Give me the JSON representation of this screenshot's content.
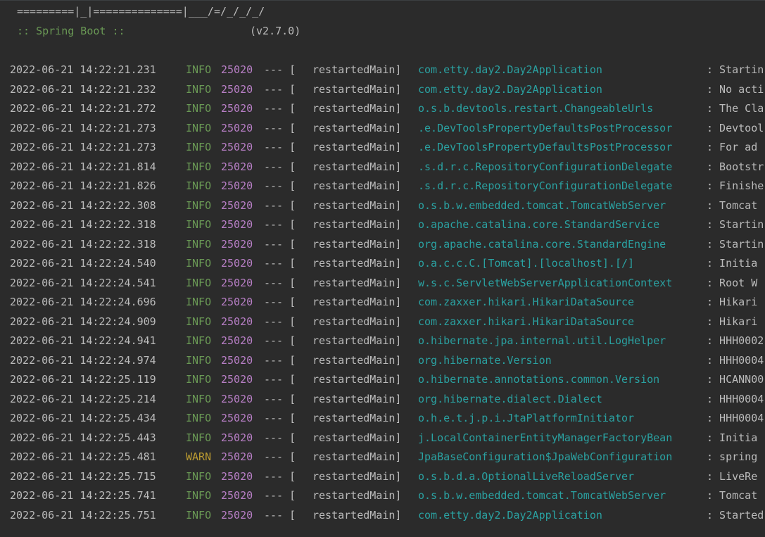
{
  "banner": {
    "art_line": "=========|_|==============|___/=/_/_/_/",
    "spring_boot_label": ":: Spring Boot ::",
    "version": "(v2.7.0)"
  },
  "colors": {
    "background": "#2b2b2b",
    "text": "#bbbbbb",
    "info": "#6a9955",
    "warn": "#bb9b31",
    "pid": "#b87fc6",
    "logger": "#2aa1a1"
  },
  "log": [
    {
      "timestamp": "2022-06-21 14:22:21.231",
      "level": "INFO",
      "pid": "25020",
      "sep": "--- [",
      "thread": "restartedMain]",
      "logger": "com.etty.day2.Day2Application",
      "message": ": Startin"
    },
    {
      "timestamp": "2022-06-21 14:22:21.232",
      "level": "INFO",
      "pid": "25020",
      "sep": "--- [",
      "thread": "restartedMain]",
      "logger": "com.etty.day2.Day2Application",
      "message": ": No acti"
    },
    {
      "timestamp": "2022-06-21 14:22:21.272",
      "level": "INFO",
      "pid": "25020",
      "sep": "--- [",
      "thread": "restartedMain]",
      "logger": "o.s.b.devtools.restart.ChangeableUrls",
      "message": ": The Cla"
    },
    {
      "timestamp": "2022-06-21 14:22:21.273",
      "level": "INFO",
      "pid": "25020",
      "sep": "--- [",
      "thread": "restartedMain]",
      "logger": ".e.DevToolsPropertyDefaultsPostProcessor",
      "message": ": Devtool"
    },
    {
      "timestamp": "2022-06-21 14:22:21.273",
      "level": "INFO",
      "pid": "25020",
      "sep": "--- [",
      "thread": "restartedMain]",
      "logger": ".e.DevToolsPropertyDefaultsPostProcessor",
      "message": ": For ad"
    },
    {
      "timestamp": "2022-06-21 14:22:21.814",
      "level": "INFO",
      "pid": "25020",
      "sep": "--- [",
      "thread": "restartedMain]",
      "logger": ".s.d.r.c.RepositoryConfigurationDelegate",
      "message": ": Bootstr"
    },
    {
      "timestamp": "2022-06-21 14:22:21.826",
      "level": "INFO",
      "pid": "25020",
      "sep": "--- [",
      "thread": "restartedMain]",
      "logger": ".s.d.r.c.RepositoryConfigurationDelegate",
      "message": ": Finishe"
    },
    {
      "timestamp": "2022-06-21 14:22:22.308",
      "level": "INFO",
      "pid": "25020",
      "sep": "--- [",
      "thread": "restartedMain]",
      "logger": "o.s.b.w.embedded.tomcat.TomcatWebServer",
      "message": ": Tomcat"
    },
    {
      "timestamp": "2022-06-21 14:22:22.318",
      "level": "INFO",
      "pid": "25020",
      "sep": "--- [",
      "thread": "restartedMain]",
      "logger": "o.apache.catalina.core.StandardService",
      "message": ": Startin"
    },
    {
      "timestamp": "2022-06-21 14:22:22.318",
      "level": "INFO",
      "pid": "25020",
      "sep": "--- [",
      "thread": "restartedMain]",
      "logger": "org.apache.catalina.core.StandardEngine",
      "message": ": Startin"
    },
    {
      "timestamp": "2022-06-21 14:22:24.540",
      "level": "INFO",
      "pid": "25020",
      "sep": "--- [",
      "thread": "restartedMain]",
      "logger": "o.a.c.c.C.[Tomcat].[localhost].[/]",
      "message": ": Initia"
    },
    {
      "timestamp": "2022-06-21 14:22:24.541",
      "level": "INFO",
      "pid": "25020",
      "sep": "--- [",
      "thread": "restartedMain]",
      "logger": "w.s.c.ServletWebServerApplicationContext",
      "message": ": Root W"
    },
    {
      "timestamp": "2022-06-21 14:22:24.696",
      "level": "INFO",
      "pid": "25020",
      "sep": "--- [",
      "thread": "restartedMain]",
      "logger": "com.zaxxer.hikari.HikariDataSource",
      "message": ": Hikari"
    },
    {
      "timestamp": "2022-06-21 14:22:24.909",
      "level": "INFO",
      "pid": "25020",
      "sep": "--- [",
      "thread": "restartedMain]",
      "logger": "com.zaxxer.hikari.HikariDataSource",
      "message": ": Hikari"
    },
    {
      "timestamp": "2022-06-21 14:22:24.941",
      "level": "INFO",
      "pid": "25020",
      "sep": "--- [",
      "thread": "restartedMain]",
      "logger": "o.hibernate.jpa.internal.util.LogHelper",
      "message": ": HHH0002"
    },
    {
      "timestamp": "2022-06-21 14:22:24.974",
      "level": "INFO",
      "pid": "25020",
      "sep": "--- [",
      "thread": "restartedMain]",
      "logger": "org.hibernate.Version",
      "message": ": HHH0004"
    },
    {
      "timestamp": "2022-06-21 14:22:25.119",
      "level": "INFO",
      "pid": "25020",
      "sep": "--- [",
      "thread": "restartedMain]",
      "logger": "o.hibernate.annotations.common.Version",
      "message": ": HCANN00"
    },
    {
      "timestamp": "2022-06-21 14:22:25.214",
      "level": "INFO",
      "pid": "25020",
      "sep": "--- [",
      "thread": "restartedMain]",
      "logger": "org.hibernate.dialect.Dialect",
      "message": ": HHH0004"
    },
    {
      "timestamp": "2022-06-21 14:22:25.434",
      "level": "INFO",
      "pid": "25020",
      "sep": "--- [",
      "thread": "restartedMain]",
      "logger": "o.h.e.t.j.p.i.JtaPlatformInitiator",
      "message": ": HHH0004"
    },
    {
      "timestamp": "2022-06-21 14:22:25.443",
      "level": "INFO",
      "pid": "25020",
      "sep": "--- [",
      "thread": "restartedMain]",
      "logger": "j.LocalContainerEntityManagerFactoryBean",
      "message": ": Initia"
    },
    {
      "timestamp": "2022-06-21 14:22:25.481",
      "level": "WARN",
      "pid": "25020",
      "sep": "--- [",
      "thread": "restartedMain]",
      "logger": "JpaBaseConfiguration$JpaWebConfiguration",
      "message": ": spring"
    },
    {
      "timestamp": "2022-06-21 14:22:25.715",
      "level": "INFO",
      "pid": "25020",
      "sep": "--- [",
      "thread": "restartedMain]",
      "logger": "o.s.b.d.a.OptionalLiveReloadServer",
      "message": ": LiveRe"
    },
    {
      "timestamp": "2022-06-21 14:22:25.741",
      "level": "INFO",
      "pid": "25020",
      "sep": "--- [",
      "thread": "restartedMain]",
      "logger": "o.s.b.w.embedded.tomcat.TomcatWebServer",
      "message": ": Tomcat"
    },
    {
      "timestamp": "2022-06-21 14:22:25.751",
      "level": "INFO",
      "pid": "25020",
      "sep": "--- [",
      "thread": "restartedMain]",
      "logger": "com.etty.day2.Day2Application",
      "message": ": Started"
    }
  ]
}
